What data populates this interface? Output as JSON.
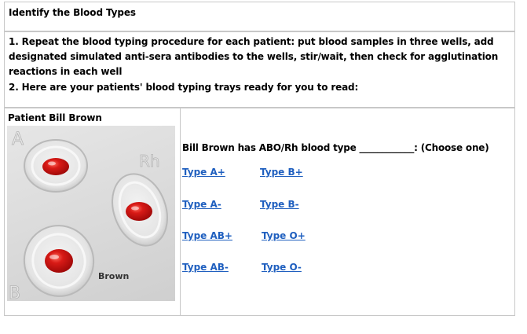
{
  "title": "Identify the Blood Types",
  "instructions": {
    "line1": "1. Repeat the blood typing procedure for each patient: put blood samples in three wells, add",
    "line2": "designated simulated anti-sera antibodies to the wells, stir/wait, then check for agglutination",
    "line3": "reactions in each well",
    "line4": "2. Here are your patients' blood typing trays ready for you to read:"
  },
  "patient": {
    "header": "Patient Bill Brown",
    "tray_label": "Brown",
    "well_labels": {
      "a": "A",
      "b": "B",
      "rh": "Rh"
    }
  },
  "question": "Bill Brown has ABO/Rh blood type ____________: (Choose one)",
  "options": {
    "a_pos": "Type A+",
    "b_pos": "Type B+",
    "a_neg": "Type A-",
    "b_neg": "Type B-",
    "ab_pos": "Type AB+",
    "o_pos": "Type O+",
    "ab_neg": "Type AB-",
    "o_neg": "Type O-"
  },
  "colors": {
    "link": "#1f5fbf",
    "blood": "#c81212",
    "border": "#c8c8c8"
  }
}
